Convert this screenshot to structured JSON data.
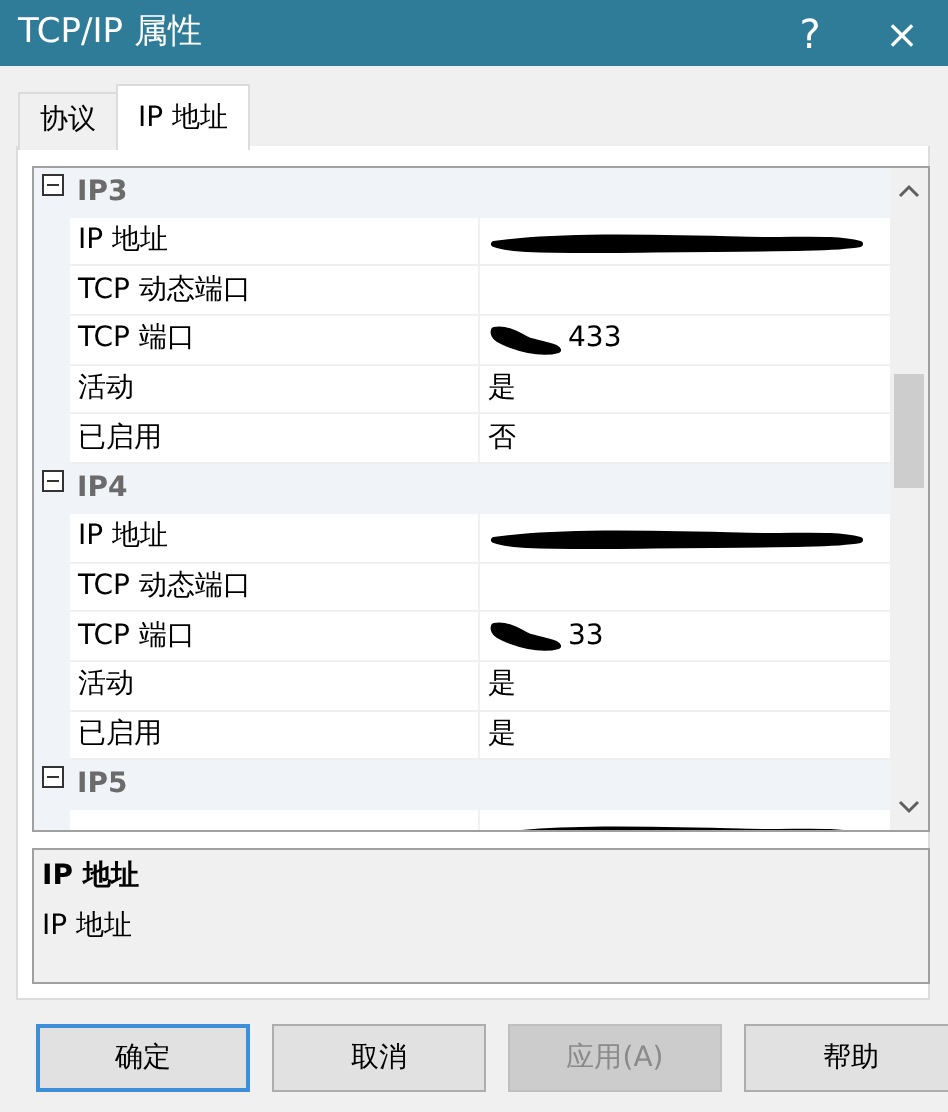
{
  "window": {
    "title": "TCP/IP 属性",
    "help": "?",
    "close": "×"
  },
  "tabs": [
    {
      "label": "协议",
      "selected": false
    },
    {
      "label": "IP 地址",
      "selected": true
    }
  ],
  "property_grid": {
    "groups": [
      {
        "name": "IP3",
        "expanded": true,
        "rows": [
          {
            "name": "IP 地址",
            "redacted": true
          },
          {
            "name": "TCP 动态端口"
          },
          {
            "name": "TCP 端口",
            "value": "433",
            "redacted": true
          },
          {
            "name": "活动",
            "value": "是"
          },
          {
            "name": "已启用",
            "value": "否"
          }
        ]
      },
      {
        "name": "IP4",
        "expanded": true,
        "rows": [
          {
            "name": "IP 地址",
            "redacted": true
          },
          {
            "name": "TCP 动态端口"
          },
          {
            "name": "TCP 端口",
            "value": "33",
            "redacted": true
          },
          {
            "name": "活动",
            "value": "是"
          },
          {
            "name": "已启用",
            "value": "是"
          }
        ]
      },
      {
        "name": "IP5",
        "expanded": true,
        "rows": [
          {
            "redacted": true
          }
        ]
      }
    ]
  },
  "description": {
    "title": "IP 地址",
    "text": "IP 地址"
  },
  "buttons": [
    {
      "label": "确定",
      "default": true,
      "disabled": false
    },
    {
      "label": "取消",
      "default": false,
      "disabled": false
    },
    {
      "label": "应用(A)",
      "default": false,
      "disabled": true
    },
    {
      "label": "帮助",
      "default": false,
      "disabled": false
    }
  ]
}
